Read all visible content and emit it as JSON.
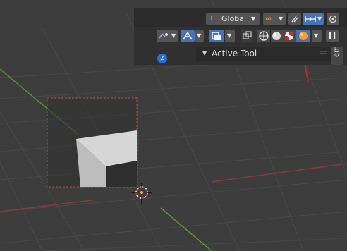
{
  "header": {
    "transform_orientation": "Global",
    "snap_toggle_glyph": "∞"
  },
  "panel": {
    "title": "Active Tool",
    "side_tab_label": "em"
  },
  "gizmo": {
    "z_label": "Z"
  },
  "icons": {
    "orientation": "transform-orientation-icon",
    "pivot": "pivot-point-icon",
    "snap": "snap-magnet-icon",
    "proportional": "proportional-editing-icon",
    "overlay": "overlay-icon",
    "visibility": "selectability-visibility-icon",
    "gizmo": "gizmo-toggle-icon",
    "xray": "xray-toggle-icon",
    "shading_wire": "wireframe-shading-icon",
    "shading_solid": "solid-shading-icon",
    "shading_material": "material-preview-icon",
    "shading_rendered": "rendered-shading-icon",
    "shading_dropdown": "shading-dropdown-icon",
    "pause": "pause-icon",
    "collapse": "collapse-icon",
    "camera_gizmo": "3d-cursor-icon"
  },
  "colors": {
    "viewport": "#3d3d3d",
    "grid": "#474747",
    "x_axis": "#9a3b3b",
    "y_axis": "#5a9a2a",
    "accent_blue": "#4772b3",
    "selection_dash": "#c04a4a"
  }
}
